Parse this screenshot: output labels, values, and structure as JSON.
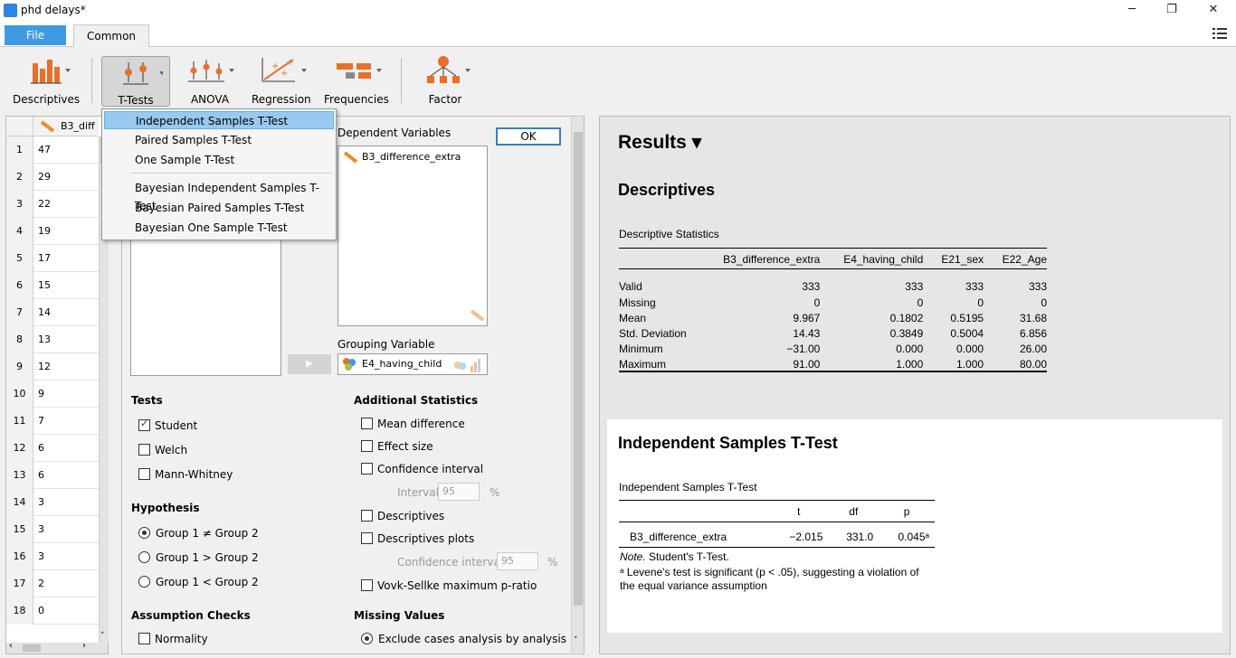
{
  "window": {
    "title": "phd delays*",
    "minimize": "─",
    "maximize": "❐",
    "close": "✕"
  },
  "tabs": {
    "file": "File",
    "common": "Common"
  },
  "toolbar": [
    {
      "label": "Descriptives",
      "icon": "descriptives-icon"
    },
    {
      "label": "T-Tests",
      "icon": "ttests-icon"
    },
    {
      "label": "ANOVA",
      "icon": "anova-icon"
    },
    {
      "label": "Regression",
      "icon": "regression-icon"
    },
    {
      "label": "Frequencies",
      "icon": "frequencies-icon"
    },
    {
      "label": "Factor",
      "icon": "factor-icon"
    }
  ],
  "datagrid": {
    "column": "B3_diff",
    "rows": [
      {
        "n": "1",
        "v": "47"
      },
      {
        "n": "2",
        "v": "29"
      },
      {
        "n": "3",
        "v": "22"
      },
      {
        "n": "4",
        "v": "19"
      },
      {
        "n": "5",
        "v": "17"
      },
      {
        "n": "6",
        "v": "15"
      },
      {
        "n": "7",
        "v": "14"
      },
      {
        "n": "8",
        "v": "13"
      },
      {
        "n": "9",
        "v": "12"
      },
      {
        "n": "10",
        "v": "9"
      },
      {
        "n": "11",
        "v": "7"
      },
      {
        "n": "12",
        "v": "6"
      },
      {
        "n": "13",
        "v": "6"
      },
      {
        "n": "14",
        "v": "3"
      },
      {
        "n": "15",
        "v": "3"
      },
      {
        "n": "16",
        "v": "3"
      },
      {
        "n": "17",
        "v": "2"
      },
      {
        "n": "18",
        "v": "0"
      }
    ]
  },
  "dropdown": {
    "items": [
      "Independent Samples T-Test",
      "Paired Samples T-Test",
      "One Sample T-Test",
      "Bayesian Independent Samples T-Test",
      "Bayesian Paired Samples T-Test",
      "Bayesian One Sample T-Test"
    ],
    "selected_index": 0
  },
  "analysis": {
    "ok": "OK",
    "dependent_label": "Dependent Variables",
    "dependent_var": "B3_difference_extra",
    "grouping_label": "Grouping Variable",
    "grouping_var": "E4_having_child",
    "arrow": "▶",
    "tests": {
      "title": "Tests",
      "student": "Student",
      "welch": "Welch",
      "mann": "Mann-Whitney"
    },
    "hypothesis": {
      "title": "Hypothesis",
      "neq": "Group 1 ≠ Group 2",
      "gt": "Group 1 > Group 2",
      "lt": "Group 1 < Group 2"
    },
    "assumption": {
      "title": "Assumption Checks",
      "normality": "Normality"
    },
    "additional": {
      "title": "Additional Statistics",
      "mean_diff": "Mean difference",
      "effect": "Effect size",
      "ci": "Confidence interval",
      "interval_label": "Interval",
      "interval_value": "95",
      "pct": "%",
      "descriptives": "Descriptives",
      "desc_plots": "Descriptives plots",
      "ci2_label": "Confidence interval",
      "ci2_value": "95",
      "pct2": "%",
      "vovk": "Vovk-Sellke maximum p-ratio"
    },
    "missing": {
      "title": "Missing Values",
      "excl": "Exclude cases analysis by analysis"
    }
  },
  "results": {
    "title": "Results ▾",
    "desc_heading": "Descriptives",
    "desc_table_title": "Descriptive Statistics",
    "desc_cols": [
      "",
      "B3_difference_extra",
      "E4_having_child",
      "E21_sex",
      "E22_Age"
    ],
    "desc_rows": [
      [
        "Valid",
        "333",
        "333",
        "333",
        "333"
      ],
      [
        "Missing",
        "0",
        "0",
        "0",
        "0"
      ],
      [
        "Mean",
        "9.967",
        "0.1802",
        "0.5195",
        "31.68"
      ],
      [
        "Std. Deviation",
        "14.43",
        "0.3849",
        "0.5004",
        "6.856"
      ],
      [
        "Minimum",
        "−31.00",
        "0.000",
        "0.000",
        "26.00"
      ],
      [
        "Maximum",
        "91.00",
        "1.000",
        "1.000",
        "80.00"
      ]
    ],
    "ttest_heading": "Independent Samples T-Test",
    "ttest_table_title": "Independent Samples T-Test",
    "ttest_cols": [
      "",
      "t",
      "df",
      "p"
    ],
    "ttest_row": [
      "B3_difference_extra",
      "−2.015",
      "331.0",
      "0.045ᵃ"
    ],
    "note_label": "Note.",
    "note_text": " Student's T-Test.",
    "footnote_line1": "ᵃ Levene's test is significant (p < .05), suggesting a violation of",
    "footnote_line2": "the equal variance assumption"
  }
}
